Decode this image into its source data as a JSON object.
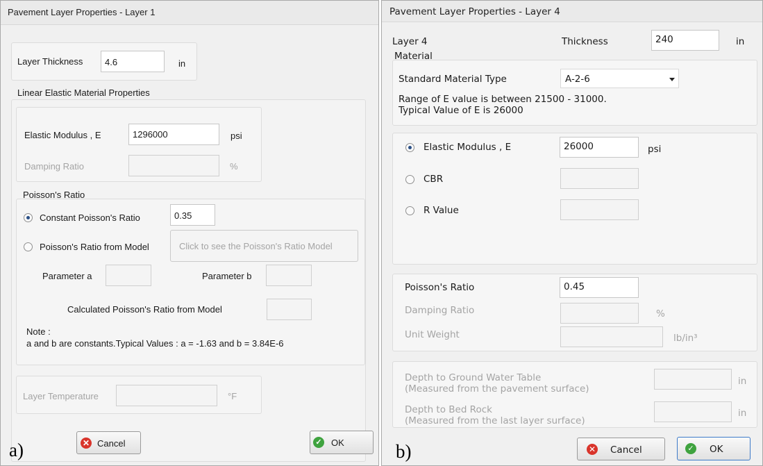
{
  "window_a": {
    "title": "Pavement Layer Properties - Layer 1",
    "layer_thickness_label": "Layer Thickness",
    "layer_thickness_value": "4.6",
    "layer_thickness_unit": "in",
    "linear_elastic_title": "Linear Elastic Material Properties",
    "elastic_modulus_label": "Elastic  Modulus , E",
    "elastic_modulus_value": "1296000",
    "elastic_modulus_unit": "psi",
    "damping_ratio_label": "Damping Ratio",
    "damping_ratio_unit": "%",
    "poisson_group_title": "Poisson's Ratio",
    "constant_poisson_label": "Constant Poisson's Ratio",
    "constant_poisson_value": "0.35",
    "poisson_model_label": "Poisson's Ratio from Model",
    "poisson_model_button": "Click to see the Poisson's Ratio Model",
    "param_a_label": "Parameter a",
    "param_b_label": "Parameter b",
    "calculated_poisson_label": "Calculated Poisson's Ratio from Model",
    "note_title": "Note :",
    "note_text": "a and b are constants.Typical Values : a = -1.63  and  b =  3.84E-6",
    "layer_temp_label": "Layer Temperature",
    "layer_temp_unit": "°F",
    "cancel_label": "Cancel",
    "ok_label": "OK",
    "caption": "a)"
  },
  "window_b": {
    "title": "Pavement Layer Properties - Layer 4",
    "layer_label": "Layer 4",
    "thickness_label": "Thickness",
    "thickness_value": "240",
    "thickness_unit": "in",
    "material_title": "Material",
    "standard_material_label": "Standard Material Type",
    "standard_material_value": "A-2-6",
    "range_line1": "Range of E value is between 21500 - 31000.",
    "range_line2": "Typical Value of E is 26000",
    "elastic_modulus_label": "Elastic  Modulus , E",
    "elastic_modulus_value": "26000",
    "elastic_modulus_unit": "psi",
    "cbr_label": "CBR",
    "r_value_label": "R Value",
    "poisson_label": "Poisson's Ratio",
    "poisson_value": "0.45",
    "damping_ratio_label": "Damping Ratio",
    "damping_ratio_unit": "%",
    "unit_weight_label": "Unit Weight",
    "unit_weight_unit": "lb/in³",
    "gwt_label_1": "Depth to Ground Water Table",
    "gwt_label_2": "(Measured from the pavement surface)",
    "gwt_unit": "in",
    "bedrock_label_1": "Depth to Bed Rock",
    "bedrock_label_2": "(Measured from the last layer surface)",
    "bedrock_unit": "in",
    "cancel_label": "Cancel",
    "ok_label": "OK",
    "caption": "b)"
  },
  "icons": {
    "radio_selected": "radio-selected-icon",
    "radio_unselected": "radio-unselected-icon",
    "cancel": "cancel-x-icon",
    "ok": "ok-check-icon",
    "dropdown": "chevron-down-icon"
  },
  "colors": {
    "window_bg": "#f0f0f0",
    "cancel_icon": "#d9342b",
    "ok_icon": "#3fa33f",
    "disabled_text": "#a4a4a4"
  }
}
